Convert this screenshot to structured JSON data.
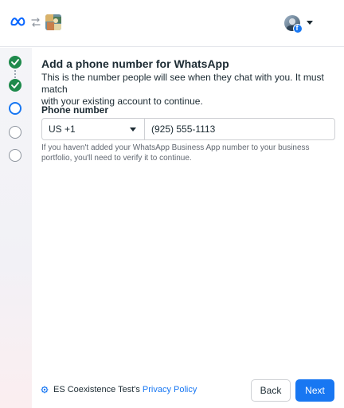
{
  "header": {
    "logo_icon": "meta-logo-icon",
    "swap_icon": "swap-arrows-icon",
    "app_icon": "app-thumbnail",
    "account_icon": "avatar",
    "badge_icon": "facebook-badge-icon"
  },
  "stepper": {
    "steps": [
      {
        "status": "completed"
      },
      {
        "status": "completed"
      },
      {
        "status": "current"
      },
      {
        "status": "upcoming"
      },
      {
        "status": "upcoming"
      }
    ],
    "colors": {
      "completed": "#1e8a4c",
      "current": "#1877f2",
      "upcoming": "#8d949e"
    }
  },
  "main": {
    "title": "Add a phone number for WhatsApp",
    "description_line1": "This is the number people will see when they chat with you. It must match",
    "description_line2": "with your existing account to continue.",
    "field_label": "Phone number",
    "country_code": "US +1",
    "phone_value": "(925) 555-1113",
    "help_line1": "If you haven't added your WhatsApp Business App number to your business",
    "help_line2": "portfolio, you'll need to verify it to continue."
  },
  "footer": {
    "business_name": "ES Coexistence Test's",
    "policy_link": "Privacy Policy",
    "back_label": "Back",
    "next_label": "Next"
  },
  "colors": {
    "accent": "#1877f2",
    "text": "#1c2b33",
    "muted": "#606770"
  }
}
